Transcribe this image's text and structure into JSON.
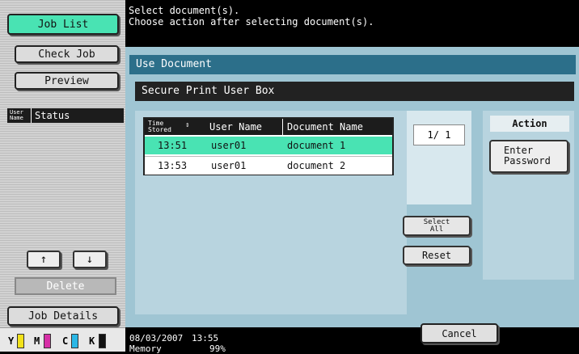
{
  "left_panel": {
    "job_list": "Job List",
    "check_job": "Check Job",
    "preview": "Preview",
    "col_user_name": "User Name",
    "col_status": "Status",
    "up_arrow": "↑",
    "down_arrow": "↓",
    "delete": "Delete",
    "job_details": "Job Details",
    "toner": {
      "y": {
        "label": "Y",
        "color": "#f2e21b"
      },
      "m": {
        "label": "M",
        "color": "#d62fa6"
      },
      "c": {
        "label": "C",
        "color": "#2bb7e6"
      },
      "k": {
        "label": "K",
        "color": "#111111"
      }
    }
  },
  "message": {
    "line1": "Select document(s).",
    "line2": "Choose action after selecting document(s)."
  },
  "main": {
    "title": "Use Document",
    "box_name": "Secure Print User Box",
    "table": {
      "headers": {
        "time": "Time Stored",
        "user": "User Name",
        "doc": "Document Name"
      },
      "rows": [
        {
          "time": "13:51",
          "user": "user01",
          "doc": "document 1"
        },
        {
          "time": "13:53",
          "user": "user01",
          "doc": "document 2"
        }
      ]
    },
    "page_counter": "1/  1",
    "select_all": "Select All",
    "reset": "Reset",
    "action_label": "Action",
    "enter_password": "Enter Password"
  },
  "bottom": {
    "date": "08/03/2007",
    "time": "13:55",
    "memory_label": "Memory",
    "memory_value": "99%",
    "cancel": "Cancel"
  },
  "colors": {
    "accent_selected": "#49e3b3",
    "title_bar": "#2c6f8a",
    "panel_bg": "#9fc5d3"
  }
}
